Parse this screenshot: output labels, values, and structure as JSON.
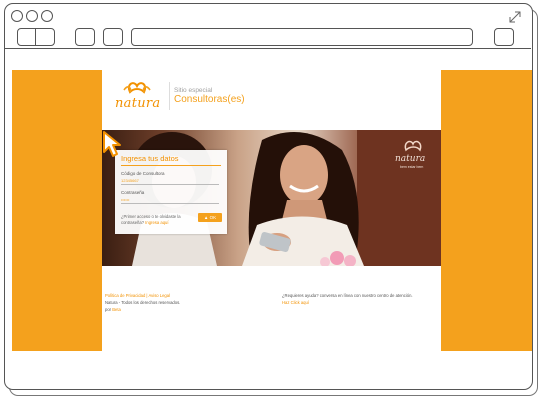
{
  "site": {
    "logo_text": "natura",
    "tagline_small": "Sitio especial",
    "tagline_big": "Consultoras(es)"
  },
  "login": {
    "title": "Ingresa tus datos",
    "code_label": "Código de Consultora",
    "code_value": "12345667",
    "password_label": "Contraseña",
    "password_value": "••••••",
    "first_access_text": "¿Primer acceso o te olvidaste la contraseña?",
    "first_access_link": "Ingresa aquí",
    "ok_label": "OK"
  },
  "hero": {
    "brand_text": "natura",
    "brand_tagline": "bem estar bem"
  },
  "footer": {
    "privacy_link": "Política de Privacidad | Aviso Legal",
    "rights": "Natura - Todos los derechos reservados.",
    "by_prefix": "por",
    "by_link": "Beta",
    "help_text": "¿Requieres ayuda? conversa en línea con nuestro centro de atención.",
    "help_link": "Haz Click aquí"
  },
  "colors": {
    "accent": "#f4a11d",
    "brand_orange": "#f29100"
  }
}
